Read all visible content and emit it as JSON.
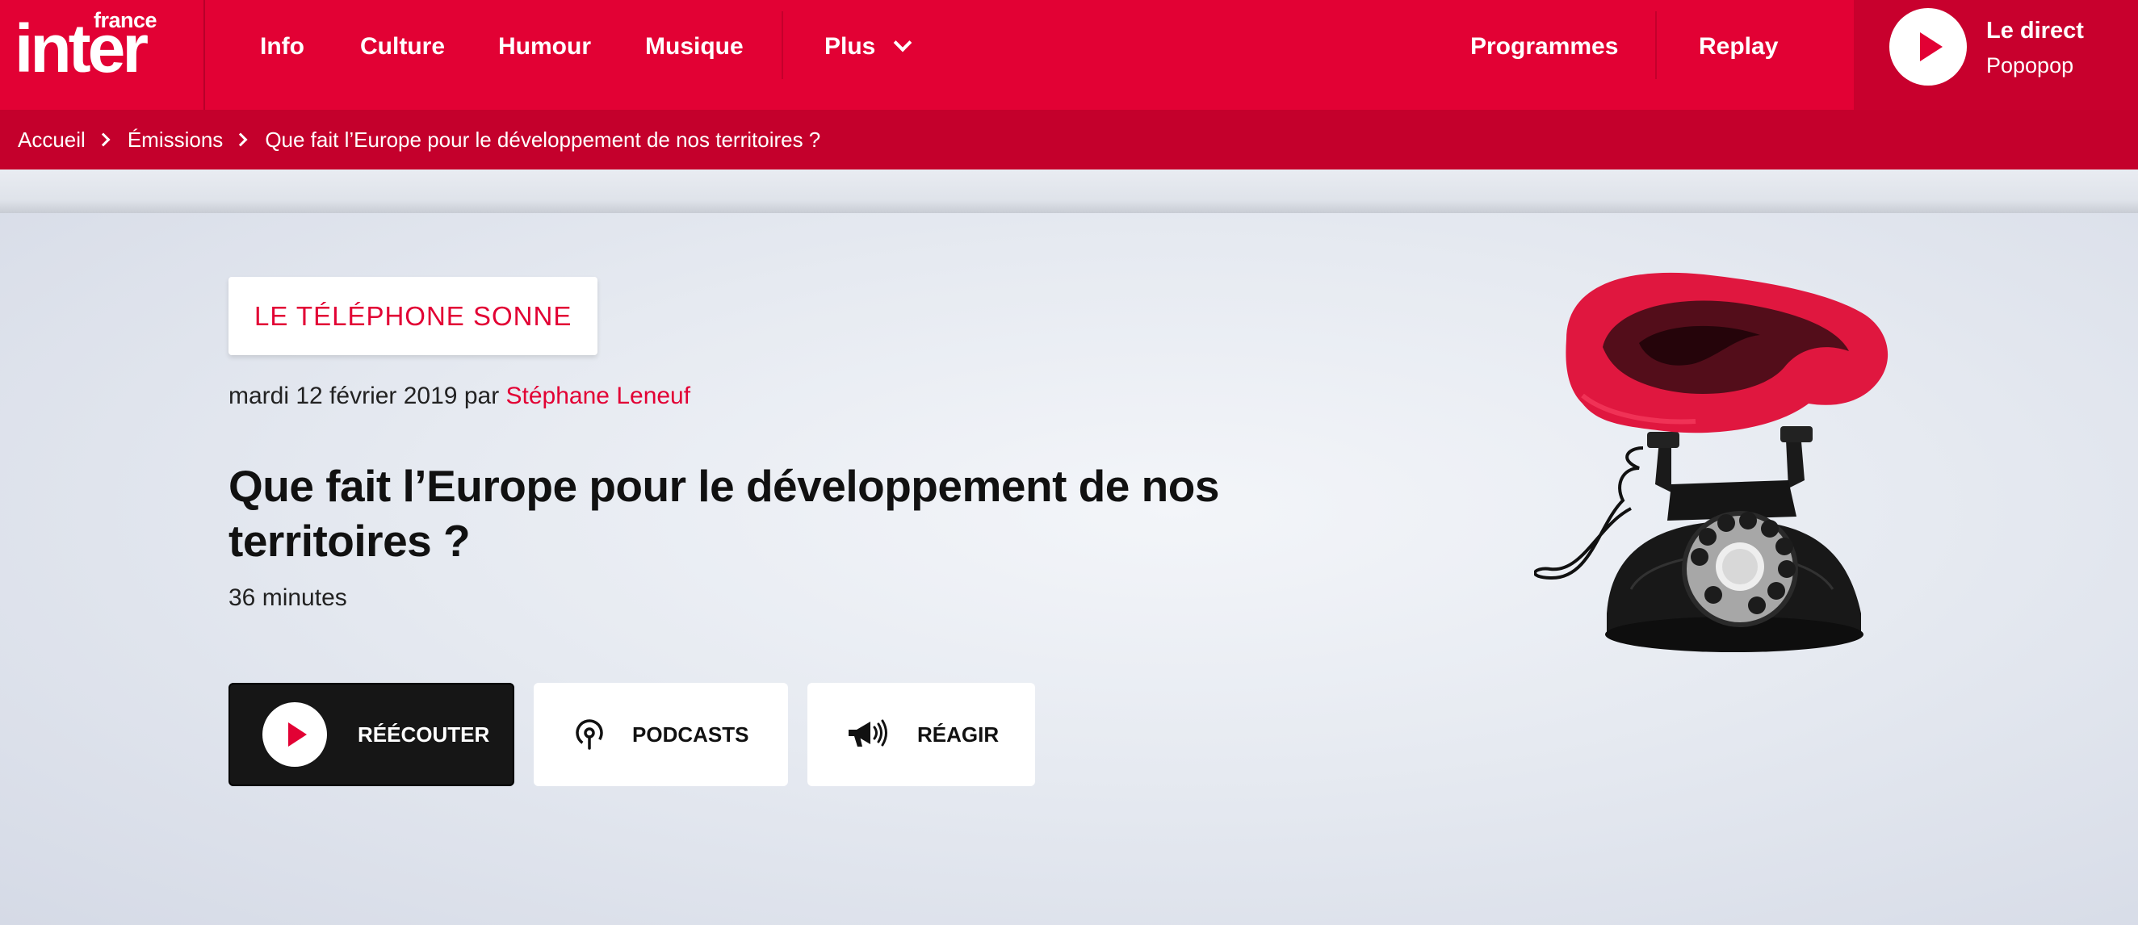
{
  "brand": {
    "line1": "france",
    "line2": "inter"
  },
  "nav": {
    "info": "Info",
    "culture": "Culture",
    "humour": "Humour",
    "musique": "Musique",
    "plus": "Plus",
    "programmes": "Programmes",
    "replay": "Replay"
  },
  "live": {
    "title": "Le direct",
    "subtitle": "Popopop"
  },
  "breadcrumb": {
    "items": [
      "Accueil",
      "Émissions",
      "Que fait l’Europe pour le développement de nos territoires ?"
    ]
  },
  "episode": {
    "show": "LE TÉLÉPHONE SONNE",
    "date": "mardi 12 février 2019",
    "by": "par",
    "author": "Stéphane Leneuf",
    "title": "Que fait l’Europe pour le développement de nos territoires ?",
    "duration": "36 minutes"
  },
  "actions": {
    "listen": "RÉÉCOUTER",
    "podcasts": "PODCASTS",
    "react": "RÉAGIR"
  },
  "colors": {
    "brand_red": "#e20134",
    "dark_red": "#c4002c",
    "button_dark": "#161616"
  },
  "icons": [
    "play-icon",
    "chevron-down-icon",
    "chevron-right-icon",
    "podcast-icon",
    "megaphone-icon"
  ]
}
